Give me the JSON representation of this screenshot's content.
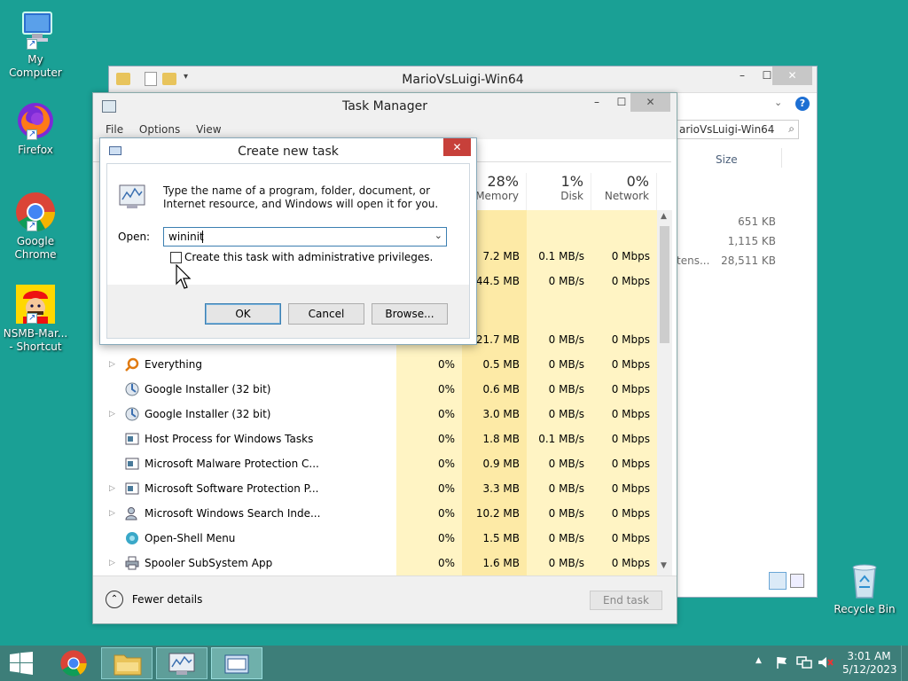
{
  "desktop": {
    "icons": [
      {
        "label": "My Computer"
      },
      {
        "label": "Firefox"
      },
      {
        "label": "Google Chrome"
      },
      {
        "label": "NSMB-Mar... - Shortcut"
      },
      {
        "label": "Recycle Bin"
      }
    ]
  },
  "explorer": {
    "title": "MarioVsLuigi-Win64",
    "search_placeholder": "arioVsLuigi-Win64",
    "size_header": "Size",
    "sizes": [
      "651 KB",
      "1,115 KB",
      "28,511 KB"
    ],
    "truncated_type": "tens..."
  },
  "taskmanager": {
    "title": "Task Manager",
    "menu": [
      "File",
      "Options",
      "View"
    ],
    "columns": [
      {
        "pct": "28%",
        "label": "Memory"
      },
      {
        "pct": "1%",
        "label": "Disk"
      },
      {
        "pct": "0%",
        "label": "Network"
      }
    ],
    "top_rows": [
      {
        "mem": "7.2 MB",
        "disk": "0.1 MB/s",
        "net": "0 Mbps"
      },
      {
        "mem": "44.5 MB",
        "disk": "0 MB/s",
        "net": "0 Mbps"
      },
      {
        "mem": "21.7 MB",
        "disk": "0 MB/s",
        "net": "0 Mbps"
      }
    ],
    "processes": [
      {
        "name": "Everything",
        "cpu": "0%",
        "mem": "0.5 MB",
        "disk": "0 MB/s",
        "net": "0 Mbps"
      },
      {
        "name": "Google Installer (32 bit)",
        "cpu": "0%",
        "mem": "0.6 MB",
        "disk": "0 MB/s",
        "net": "0 Mbps"
      },
      {
        "name": "Google Installer (32 bit)",
        "cpu": "0%",
        "mem": "3.0 MB",
        "disk": "0 MB/s",
        "net": "0 Mbps"
      },
      {
        "name": "Host Process for Windows Tasks",
        "cpu": "0%",
        "mem": "1.8 MB",
        "disk": "0.1 MB/s",
        "net": "0 Mbps"
      },
      {
        "name": "Microsoft Malware Protection C...",
        "cpu": "0%",
        "mem": "0.9 MB",
        "disk": "0 MB/s",
        "net": "0 Mbps"
      },
      {
        "name": "Microsoft Software Protection P...",
        "cpu": "0%",
        "mem": "3.3 MB",
        "disk": "0 MB/s",
        "net": "0 Mbps"
      },
      {
        "name": "Microsoft Windows Search Inde...",
        "cpu": "0%",
        "mem": "10.2 MB",
        "disk": "0 MB/s",
        "net": "0 Mbps"
      },
      {
        "name": "Open-Shell Menu",
        "cpu": "0%",
        "mem": "1.5 MB",
        "disk": "0 MB/s",
        "net": "0 Mbps"
      },
      {
        "name": "Spooler SubSystem App",
        "cpu": "0%",
        "mem": "1.6 MB",
        "disk": "0 MB/s",
        "net": "0 Mbps"
      }
    ],
    "fewer_details": "Fewer details",
    "end_task": "End task"
  },
  "dialog": {
    "title": "Create new task",
    "description": "Type the name of a program, folder, document, or Internet resource, and Windows will open it for you.",
    "open_label": "Open:",
    "open_value": "wininit",
    "admin_label": "Create this task with administrative privileges.",
    "ok": "OK",
    "cancel": "Cancel",
    "browse": "Browse..."
  },
  "taskbar": {
    "time": "3:01 AM",
    "date": "5/12/2023"
  },
  "colors": {
    "desktop": "#1aa095",
    "taskbar": "#3d7e79",
    "heat_light": "#fff4c4",
    "heat_medium": "#fdeaa6",
    "close_red": "#c7403a"
  }
}
